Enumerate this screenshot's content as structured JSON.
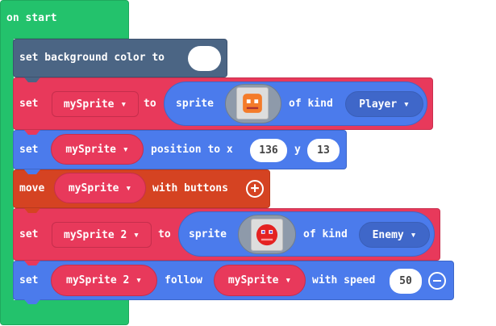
{
  "colors": {
    "events": "#23c26c",
    "scene": "#4b6584",
    "variables": "#e8395b",
    "sprites": "#4b7bec",
    "controller": "#d54322"
  },
  "on_start": {
    "label": "on start"
  },
  "bg_block": {
    "label": "set background color to",
    "color_value": "#ffffff"
  },
  "set1": {
    "set": "set",
    "var": "mySprite",
    "to": "to",
    "sprite": "sprite",
    "image": "orange-face-sprite",
    "of_kind": "of kind",
    "kind": "Player"
  },
  "pos": {
    "set": "set",
    "var": "mySprite",
    "label": "position to x",
    "x": "136",
    "y_label": "y",
    "y": "13"
  },
  "move": {
    "move": "move",
    "var": "mySprite",
    "label": "with buttons"
  },
  "set2": {
    "set": "set",
    "var": "mySprite 2",
    "to": "to",
    "sprite": "sprite",
    "image": "red-ghost-sprite",
    "of_kind": "of kind",
    "kind": "Enemy"
  },
  "follow": {
    "set": "set",
    "var": "mySprite 2",
    "follow": "follow",
    "target": "mySprite",
    "with_speed": "with speed",
    "speed": "50"
  },
  "dropdown_arrow": "▾"
}
